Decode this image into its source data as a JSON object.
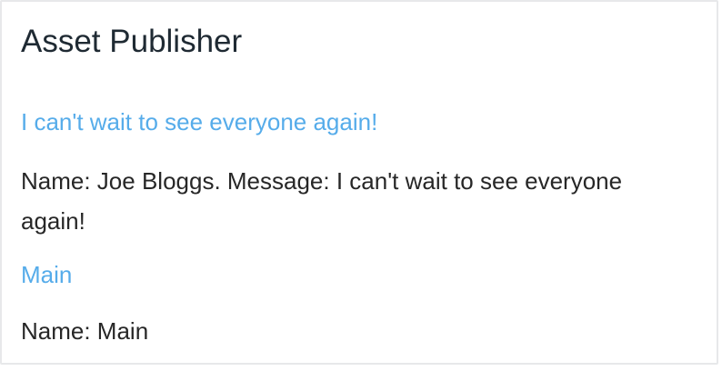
{
  "portlet": {
    "title": "Asset Publisher"
  },
  "entries": [
    {
      "title": "I can't wait to see everyone again!",
      "summary": "Name: Joe Bloggs. Message: I can't wait to see everyone again!"
    },
    {
      "title": "Main",
      "summary": "Name: Main"
    }
  ],
  "colors": {
    "link": "#56acea",
    "title": "#1f2a33",
    "text": "#272727",
    "border": "#e7e8ea"
  }
}
